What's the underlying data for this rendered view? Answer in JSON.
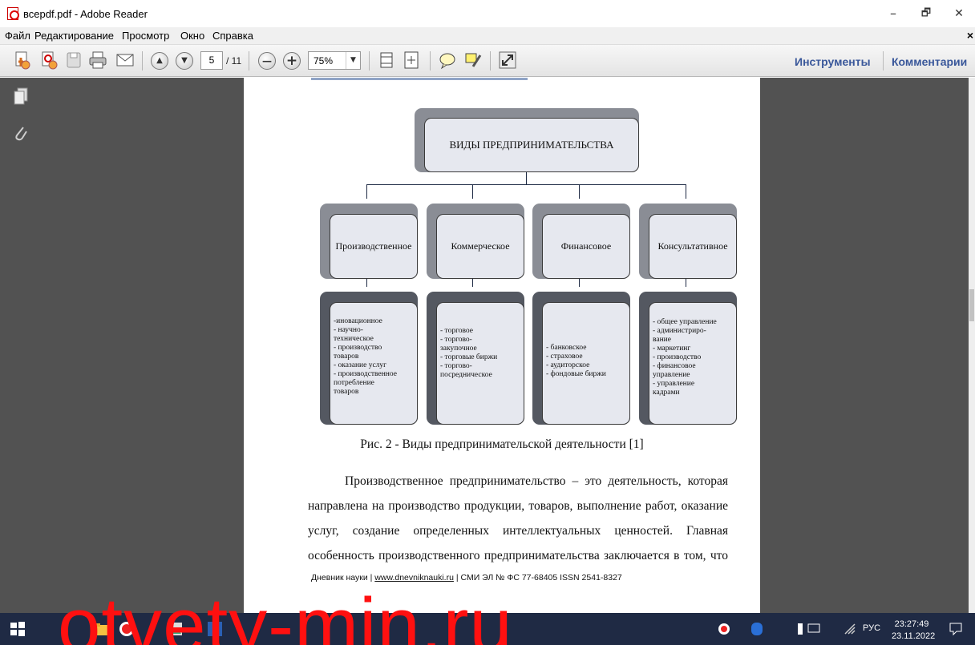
{
  "window": {
    "title": "всеpdf.pdf - Adobe Reader",
    "minimize": "–",
    "maximize": "🗗",
    "close": "✕"
  },
  "menu": {
    "items": [
      "Файл",
      "Редактирование",
      "Просмотр",
      "Окно",
      "Справка"
    ],
    "close": "×"
  },
  "toolbar": {
    "page_current": "5",
    "page_total": "/ 11",
    "zoom": "75%",
    "tools_label": "Инструменты",
    "comments_label": "Комментарии"
  },
  "diagram": {
    "root": "ВИДЫ ПРЕДПРИНИМАТЕЛЬСТВА",
    "categories": [
      "Производственное",
      "Коммерческое",
      "Финансовое",
      "Консультативное"
    ],
    "details": [
      [
        "-иновационное",
        "- научно-",
        "техническое",
        "- производство",
        "товаров",
        "- оказание услуг",
        "- производственное",
        "потребление",
        "товаров"
      ],
      [
        "- торговое",
        "- торгово-",
        "закупочное",
        "- торговые биржи",
        "- торгово-",
        "посредническое"
      ],
      [
        "- банковское",
        "- страховое",
        "- аудиторское",
        "- фондовые биржи"
      ],
      [
        "- общее управление",
        "- администриро-",
        "вание",
        "- маркетинг",
        "- производство",
        "- финансовое",
        "управление",
        "- управление",
        "кадрами"
      ]
    ]
  },
  "caption": "Рис. 2 - Виды предпринимательской деятельности [1]",
  "paragraph": [
    "Производственное предпринимательство – это деятельность, которая",
    "направлена на производство продукции, товаров, выполнение работ, оказание",
    "услуг, создание определенных интеллектуальных ценностей. Главная",
    "особенность производственного предпринимательства заключается в том, что"
  ],
  "footer": {
    "prefix": "Дневник науки | ",
    "link": "www.dnevniknauki.ru",
    "suffix": " | СМИ ЭЛ № ФС 77-68405 ISSN 2541-8327"
  },
  "watermark": "otvety-min.ru",
  "tray": {
    "lang": "РУС",
    "time": "23:27:49",
    "date": "23.11.2022"
  }
}
